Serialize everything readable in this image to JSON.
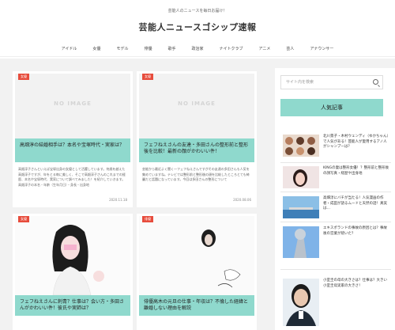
{
  "header": {
    "tagline": "芸能人のニュースを毎日お届け！",
    "site_title": "芸能人ニュースゴシップ速報"
  },
  "nav": {
    "items": [
      {
        "label": "アイドル"
      },
      {
        "label": "女優"
      },
      {
        "label": "モデル"
      },
      {
        "label": "俳優"
      },
      {
        "label": "歌手"
      },
      {
        "label": "政治家"
      },
      {
        "label": "ナイトクラブ"
      },
      {
        "label": "アニメ"
      },
      {
        "label": "芸人"
      },
      {
        "label": "アナウンサー"
      }
    ]
  },
  "posts": [
    {
      "badge": "女優",
      "noimage": "NO IMAGE",
      "title": "高畑淳の結婚相手は？本名や宝塚時代・実家は？",
      "excerpt": "高畑淳子さんといえば宝塚出身の女優として活躍しています。何歳を越えた高畑淳子ですが、年をとる毎に美しく、そこで高畑淳子さんのこれまでの経歴、本名や宝塚時代、実家について調べてみました！を紹介していきます。 高畑淳子の本名・年齢（生年月日）・身長・出身地",
      "date": "2020.11.18"
    },
    {
      "badge": "女優",
      "noimage": "NO IMAGE",
      "title": "フェフねえさんの友達・多田さんの整形前と整形後を比較！最新の顔がかわいい件！",
      "excerpt": "芸能から最近よく聞く一フェフねえさんですがその友達の多田さんも人気を集めていますね。テレビでは整形前と整形後の顔を比較したところとても綺麗だと話題になっています。今回は多田さんの整形について",
      "date": "2020.08.06"
    },
    {
      "badge": "女優",
      "title": "フェフねえさんに刺青？仕事は？会い方・多田さんがかわいい件！彼氏や実姉は？"
    },
    {
      "badge": "俳優",
      "title": "俳優高木の元旦の仕事・年収は？不倫した経緯と離婚しない理由を解説"
    }
  ],
  "sidebar": {
    "search_placeholder": "サイト内を検索",
    "popular_label": "人気記事",
    "popular": [
      {
        "title": "北川景子・木村ウェンディ（ゆかちゃん）で人気がある！芸能人が愛用するアノ人がシャンプーは？"
      },
      {
        "title": "KINGの妻は整形女優！？整形前と整形後の顔写真・経歴や出身地"
      },
      {
        "title": "高畑淳にバチが当たる！人気漫画の作者・成田が語るムードと天然の話！真実は…"
      },
      {
        "title": "エキスポランドの事故の原因とは？事故後の営業が続いた？"
      },
      {
        "title": "小室圭の母の大きさは？仕事は？大きい小室圭母実家の大きさ！"
      }
    ]
  },
  "colors": {
    "accent_mint": "#8fd9cd",
    "badge_red": "#e74c3c",
    "page_bg": "#f2f2f2"
  }
}
